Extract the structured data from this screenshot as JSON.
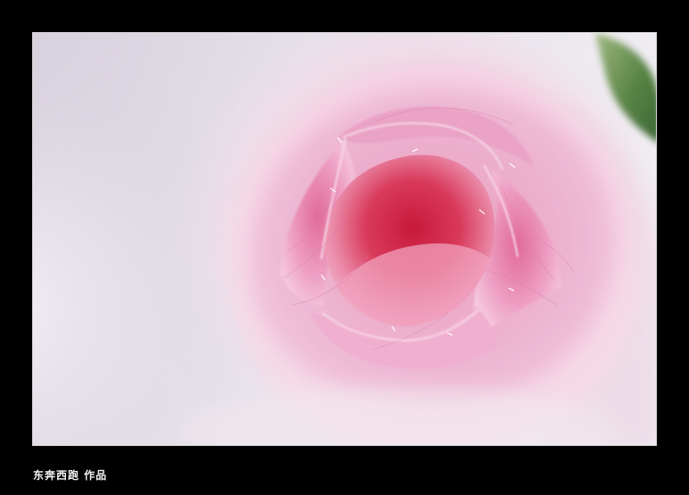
{
  "caption": {
    "text": "东奔西跑 作品"
  },
  "photo": {
    "subject": "pink-rose-bud-closeup",
    "colors": {
      "frame_background": "#000000",
      "border": "#d8d8d8",
      "background_lilac": "#ddd6e4",
      "petal_pink": "#f1bfd8",
      "petal_deep_pink": "#e48fb6",
      "center_red": "#c81f3b",
      "leaf_green": "#3c6b2e"
    }
  }
}
